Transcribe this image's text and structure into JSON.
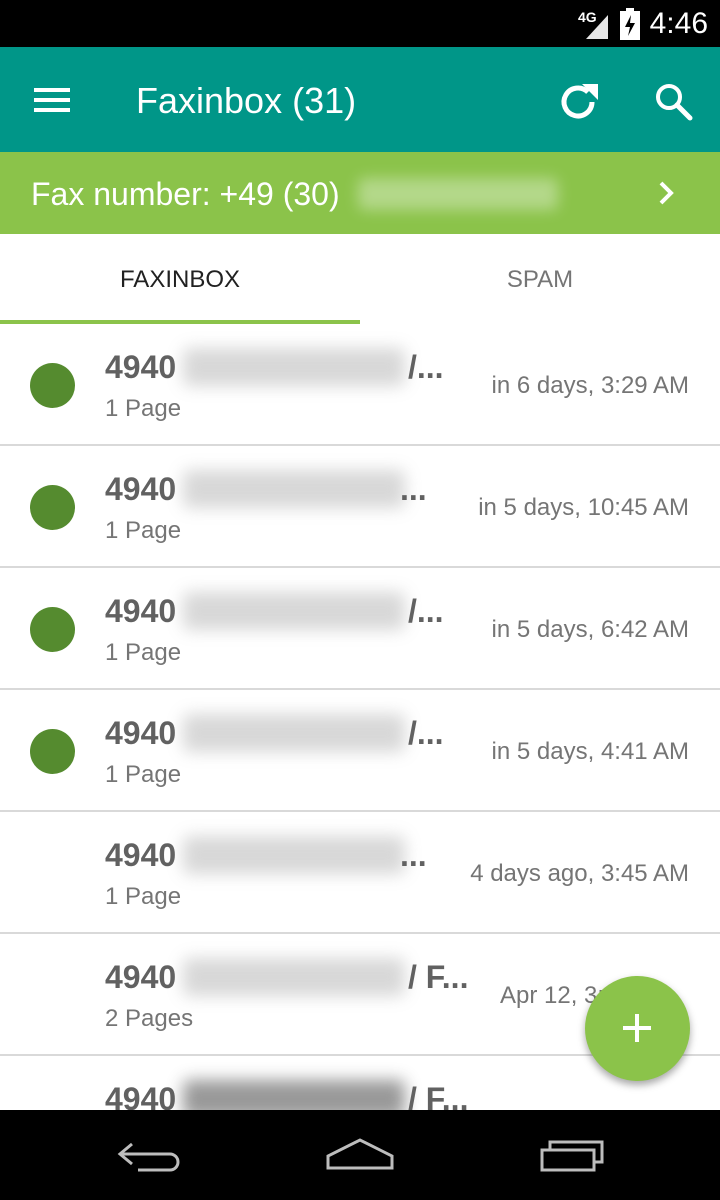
{
  "status_bar": {
    "network": "4G",
    "time": "4:46"
  },
  "app_bar": {
    "title": "Faxinbox (31)",
    "menu_icon": "hamburger-menu-icon",
    "refresh_icon": "refresh-icon",
    "search_icon": "search-icon"
  },
  "fax_bar": {
    "label": "Fax number: +49 (30)"
  },
  "tabs": [
    {
      "label": "FAXINBOX",
      "selected": true
    },
    {
      "label": "SPAM",
      "selected": false
    }
  ],
  "faxes": [
    {
      "sender_prefix": "4940",
      "sender_suffix": "/...",
      "pages": "1 Page",
      "time": "in 6 days, 3:29 AM",
      "unread": true
    },
    {
      "sender_prefix": "4940",
      "sender_suffix": "...",
      "pages": "1 Page",
      "time": "in 5 days, 10:45 AM",
      "unread": true
    },
    {
      "sender_prefix": "4940",
      "sender_suffix": "/...",
      "pages": "1 Page",
      "time": "in 5 days, 6:42 AM",
      "unread": true
    },
    {
      "sender_prefix": "4940",
      "sender_suffix": "/...",
      "pages": "1 Page",
      "time": "in 5 days, 4:41 AM",
      "unread": true
    },
    {
      "sender_prefix": "4940",
      "sender_suffix": "...",
      "pages": "1 Page",
      "time": "4 days ago, 3:45 AM",
      "unread": false
    },
    {
      "sender_prefix": "4940",
      "sender_suffix": "/ F...",
      "pages": "2 Pages",
      "time": "Apr 12, 3:",
      "unread": false
    },
    {
      "sender_prefix": "4940",
      "sender_suffix": "/ F...",
      "pages": "",
      "time": "",
      "unread": false
    }
  ],
  "fab": {
    "label": "+",
    "icon": "plus-icon"
  },
  "nav_bar": {
    "back_icon": "back-icon",
    "home_icon": "home-icon",
    "recents_icon": "recents-icon"
  }
}
